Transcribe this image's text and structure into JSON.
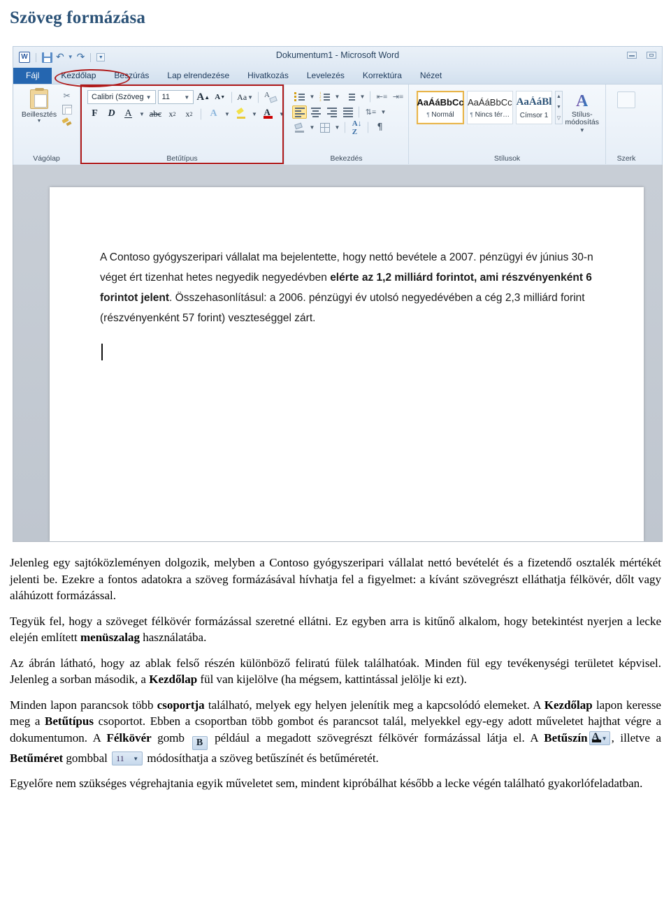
{
  "page": {
    "title": "Szöveg formázása"
  },
  "word": {
    "window_title": "Dokumentum1 - Microsoft Word",
    "quick_access": {
      "word_logo": "W",
      "save": "save-icon",
      "undo": "undo-icon",
      "redo": "redo-icon",
      "customize": "customize-icon"
    },
    "window_buttons": {
      "minimize": "minimize-icon",
      "restore": "restore-icon"
    },
    "tabs": [
      {
        "label": "Fájl",
        "state": "file"
      },
      {
        "label": "Kezdőlap",
        "state": "active"
      },
      {
        "label": "Beszúrás",
        "state": "normal"
      },
      {
        "label": "Lap elrendezése",
        "state": "normal"
      },
      {
        "label": "Hivatkozás",
        "state": "normal"
      },
      {
        "label": "Levelezés",
        "state": "normal"
      },
      {
        "label": "Korrektúra",
        "state": "normal"
      },
      {
        "label": "Nézet",
        "state": "normal"
      }
    ],
    "groups": {
      "clipboard": {
        "label": "Vágólap",
        "paste_label": "Beillesztés",
        "cut": "scissors-icon",
        "copy": "copy-icon",
        "format_painter": "format-painter-icon"
      },
      "font": {
        "label": "Betűtípus",
        "font_name": "Calibri (Szöveg",
        "font_size": "11",
        "grow_font": "A",
        "shrink_font": "A",
        "change_case": "Aa",
        "clear_formatting": "clear-formatting-icon",
        "bold": "F",
        "italic": "D",
        "underline": "A",
        "strikethrough": "abc",
        "subscript": "x",
        "superscript": "x",
        "text_effects": "A",
        "highlight": "highlight-icon",
        "font_color": "A"
      },
      "paragraph": {
        "label": "Bekezdés",
        "bullets": "bullet-list-icon",
        "numbering": "numbered-list-icon",
        "multilevel": "multilevel-list-icon",
        "decrease_indent": "decrease-indent-icon",
        "increase_indent": "increase-indent-icon",
        "align_left": "align-left-icon",
        "align_center": "align-center-icon",
        "align_right": "align-right-icon",
        "justify": "justify-icon",
        "line_spacing": "line-spacing-icon",
        "shading": "shading-icon",
        "borders": "borders-icon",
        "sort": "sort-icon",
        "show_marks": "¶"
      },
      "styles": {
        "label": "Stílusok",
        "cards": [
          {
            "sample": "AaÁáBbCc",
            "name": "Normál",
            "selected": true
          },
          {
            "sample": "AaÁáBbCc",
            "name": "Nincs tér…",
            "selected": false
          },
          {
            "sample": "AaÁáBl",
            "name": "Címsor 1",
            "selected": false
          }
        ],
        "change_styles_label": "Stílus-\nmódosítás"
      },
      "editing": {
        "label": "Szerk"
      }
    },
    "document_text": [
      {
        "text": "A Contoso gyógyszeripari vállalat ma bejelentette, hogy nettó bevétele a 2007. pénzügyi év június 30-n véget ért tizenhat hetes negyedik negyedévben ",
        "bold": false
      },
      {
        "text": "elérte az 1,2 milliárd forintot, ami részvényenként 6 forintot jelent",
        "bold": true
      },
      {
        "text": ". Összehasonlításul: a 2006. pénzügyi év utolsó negyedévében a cég 2,3 milliárd forint (részvényenként 57 forint) veszteséggel zárt.",
        "bold": false
      }
    ]
  },
  "body": {
    "p1_a": "Jelenleg egy sajtóközleményen dolgozik, melyben a Contoso gyógyszeripari vállalat nettó bevételét és a fizetendő osztalék mértékét jelenti be. Ezekre a fontos adatokra a szöveg formázásával hívhatja fel a figyelmet: a kívánt szövegrészt elláthatja félkövér, dőlt vagy aláhúzott formázással.",
    "p2_a": "Tegyük fel, hogy a szöveget félkövér formázással szeretné ellátni. Ez egyben arra is kitűnő alkalom, hogy betekintést nyerjen a lecke elején említett ",
    "p2_b": "menüszalag",
    "p2_c": " használatába.",
    "p3_a": "Az ábrán látható, hogy az ablak felső részén különböző feliratú fülek találhatóak. Minden fül egy tevékenységi területet képvisel. Jelenleg a sorban második, a ",
    "p3_b": "Kezdőlap",
    "p3_c": " fül van kijelölve (ha mégsem, kattintással jelölje ki ezt).",
    "p4_a": "Minden lapon parancsok több ",
    "p4_b": "csoportja",
    "p4_c": " található, melyek egy helyen jelenítik meg a kapcsolódó elemeket. A ",
    "p4_d": "Kezdőlap",
    "p4_e": " lapon keresse meg a ",
    "p4_f": "Betűtípus",
    "p4_g": " csoportot. Ebben a csoportban több gombot és parancsot talál, melyekkel egy-egy adott műveletet hajthat végre a dokumentumon. A ",
    "p4_h": "Félkövér",
    "p4_i": " gomb ",
    "p4_j": " például a megadott szövegrészt félkövér formázással látja el. A ",
    "p4_k": "Betűszín",
    "p4_l": ", illetve a ",
    "p4_m": "Betűméret",
    "p4_n": " gombbal ",
    "p4_o": " módosíthatja a szöveg betűszínét és betűméretét.",
    "p5_a": "Egyelőre nem szükséges végrehajtania egyik műveletet sem, mindent kipróbálhat később a lecke végén található gyakorlófeladatban.",
    "inline_bold_glyph": "B",
    "inline_color_glyph": "A",
    "inline_size_value": "11"
  },
  "colors": {
    "heading": "#2b5277",
    "highlight_red": "#b01a1a",
    "file_tab_blue": "#2566b0",
    "selected_style_gold": "#e8b44a"
  }
}
